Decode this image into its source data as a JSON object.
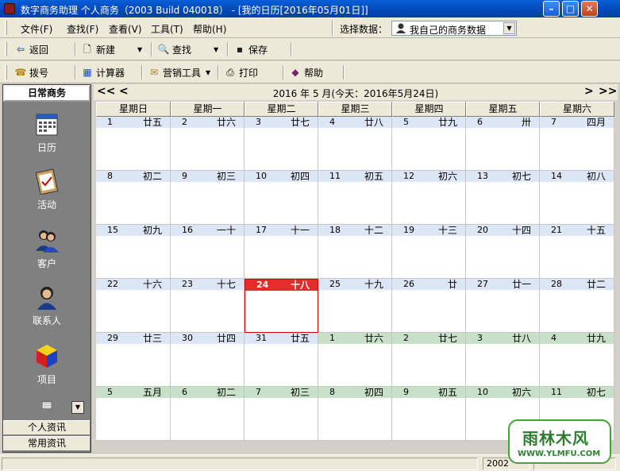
{
  "window": {
    "title": "数字商务助理  个人商务（2003 Build 040018） - [我的日历[2016年05月01日]]"
  },
  "menu": {
    "items": [
      "文件(F)",
      "查找(F)",
      "查看(V)",
      "工具(T)",
      "帮助(H)"
    ],
    "data_select_label": "选择数据：",
    "data_select_value": "我自己的商务数据"
  },
  "toolbar1": {
    "back": "返回",
    "new": "新建",
    "find": "查找",
    "save": "保存"
  },
  "toolbar2": {
    "dial": "拨号",
    "calculator": "计算器",
    "marketing": "营销工具",
    "print": "打印",
    "help": "帮助"
  },
  "leftnav": {
    "header": "日常商务",
    "items": [
      {
        "label": "日历",
        "icon": "calendar-icon"
      },
      {
        "label": "活动",
        "icon": "clipboard-icon"
      },
      {
        "label": "客户",
        "icon": "customers-icon"
      },
      {
        "label": "联系人",
        "icon": "contact-icon"
      },
      {
        "label": "项目",
        "icon": "project-cube-icon"
      }
    ],
    "tabs": [
      "个人资讯",
      "常用资讯"
    ]
  },
  "calendar": {
    "nav": {
      "prev_year": "<<",
      "prev_month": "<",
      "next_month": ">",
      "next_year": ">>"
    },
    "title": "2016 年 5 月(今天：2016年5月24日)",
    "weekdays": [
      "星期日",
      "星期一",
      "星期二",
      "星期三",
      "星期四",
      "星期五",
      "星期六"
    ],
    "today_index": 23,
    "days": [
      {
        "d": "1",
        "l": "廿五",
        "other": false
      },
      {
        "d": "2",
        "l": "廿六",
        "other": false
      },
      {
        "d": "3",
        "l": "廿七",
        "other": false
      },
      {
        "d": "4",
        "l": "廿八",
        "other": false
      },
      {
        "d": "5",
        "l": "廿九",
        "other": false
      },
      {
        "d": "6",
        "l": "卅",
        "other": false
      },
      {
        "d": "7",
        "l": "四月",
        "other": false
      },
      {
        "d": "8",
        "l": "初二",
        "other": false
      },
      {
        "d": "9",
        "l": "初三",
        "other": false
      },
      {
        "d": "10",
        "l": "初四",
        "other": false
      },
      {
        "d": "11",
        "l": "初五",
        "other": false
      },
      {
        "d": "12",
        "l": "初六",
        "other": false
      },
      {
        "d": "13",
        "l": "初七",
        "other": false
      },
      {
        "d": "14",
        "l": "初八",
        "other": false
      },
      {
        "d": "15",
        "l": "初九",
        "other": false
      },
      {
        "d": "16",
        "l": "一十",
        "other": false
      },
      {
        "d": "17",
        "l": "十一",
        "other": false
      },
      {
        "d": "18",
        "l": "十二",
        "other": false
      },
      {
        "d": "19",
        "l": "十三",
        "other": false
      },
      {
        "d": "20",
        "l": "十四",
        "other": false
      },
      {
        "d": "21",
        "l": "十五",
        "other": false
      },
      {
        "d": "22",
        "l": "十六",
        "other": false
      },
      {
        "d": "23",
        "l": "十七",
        "other": false
      },
      {
        "d": "24",
        "l": "十八",
        "other": false
      },
      {
        "d": "25",
        "l": "十九",
        "other": false
      },
      {
        "d": "26",
        "l": "廿",
        "other": false
      },
      {
        "d": "27",
        "l": "廿一",
        "other": false
      },
      {
        "d": "28",
        "l": "廿二",
        "other": false
      },
      {
        "d": "29",
        "l": "廿三",
        "other": false
      },
      {
        "d": "30",
        "l": "廿四",
        "other": false
      },
      {
        "d": "31",
        "l": "廿五",
        "other": false
      },
      {
        "d": "1",
        "l": "廿六",
        "other": true
      },
      {
        "d": "2",
        "l": "廿七",
        "other": true
      },
      {
        "d": "3",
        "l": "廿八",
        "other": true
      },
      {
        "d": "4",
        "l": "廿九",
        "other": true
      },
      {
        "d": "5",
        "l": "五月",
        "other": true
      },
      {
        "d": "6",
        "l": "初二",
        "other": true
      },
      {
        "d": "7",
        "l": "初三",
        "other": true
      },
      {
        "d": "8",
        "l": "初四",
        "other": true
      },
      {
        "d": "9",
        "l": "初五",
        "other": true
      },
      {
        "d": "10",
        "l": "初六",
        "other": true
      },
      {
        "d": "11",
        "l": "初七",
        "other": true
      }
    ]
  },
  "statusbar": {
    "year": "2002"
  },
  "watermark": {
    "text": "雨林木风",
    "url": "WWW.YLMFU.COM"
  },
  "colors": {
    "titlebar": "#0348b8",
    "band_current": "#dde6f4",
    "band_other": "#c8e0c8",
    "today": "#e62b2b",
    "nav_bg": "#808080"
  }
}
